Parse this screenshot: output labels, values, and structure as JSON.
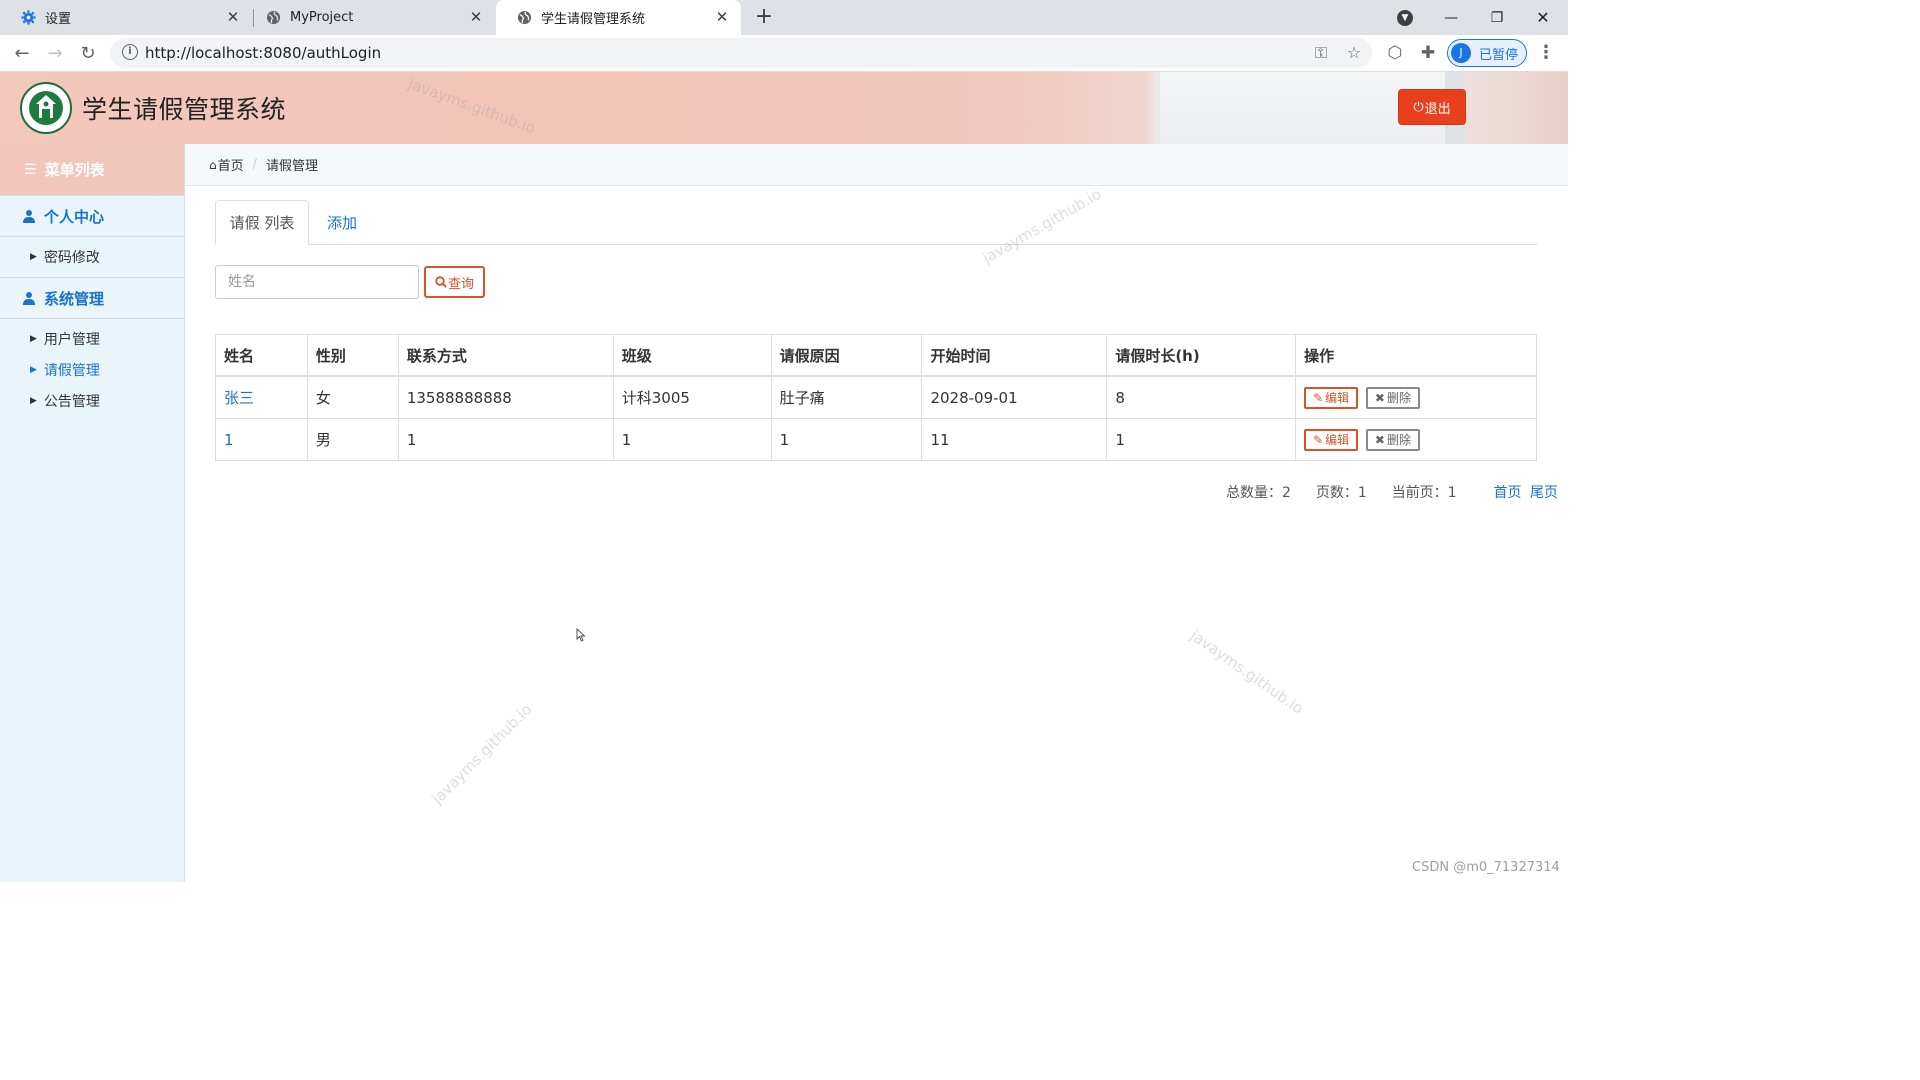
{
  "browser": {
    "tabs": [
      {
        "title": "设置",
        "icon": "gear-icon"
      },
      {
        "title": "MyProject",
        "icon": "globe-icon"
      },
      {
        "title": "学生请假管理系统",
        "icon": "globe-icon"
      }
    ],
    "url": "http://localhost:8080/authLogin",
    "profile_initial": "J",
    "profile_label": "已暂停"
  },
  "app": {
    "title": "学生请假管理系统",
    "logout_label": "退出"
  },
  "sidebar": {
    "header": "菜单列表",
    "sections": [
      {
        "label": "个人中心",
        "items": [
          "密码修改"
        ]
      },
      {
        "label": "系统管理",
        "items": [
          "用户管理",
          "请假管理",
          "公告管理"
        ]
      }
    ],
    "active_item": "请假管理"
  },
  "breadcrumb": {
    "home": "首页",
    "current": "请假管理"
  },
  "tabs": {
    "list": "请假 列表",
    "add": "添加"
  },
  "search": {
    "placeholder": "姓名",
    "button": "查询"
  },
  "table": {
    "headers": [
      "姓名",
      "性别",
      "联系方式",
      "班级",
      "请假原因",
      "开始时间",
      "请假时长(h)",
      "操作"
    ],
    "rows": [
      {
        "name": "张三",
        "gender": "女",
        "phone": "13588888888",
        "class": "计科3005",
        "reason": "肚子痛",
        "start": "2028-09-01",
        "hours": "8"
      },
      {
        "name": "1",
        "gender": "男",
        "phone": "1",
        "class": "1",
        "reason": "1",
        "start": "11",
        "hours": "1"
      }
    ],
    "edit_label": "编辑",
    "delete_label": "删除"
  },
  "pager": {
    "total": "总数量：2",
    "pages": "页数：1",
    "current": "当前页：1",
    "first": "首页",
    "last": "尾页"
  },
  "watermark": "javayms.github.io",
  "footer_credit": "CSDN @m0_71327314",
  "colors": {
    "accent": "#1a73c9",
    "danger": "#e8401c",
    "edit": "#d9532a"
  }
}
